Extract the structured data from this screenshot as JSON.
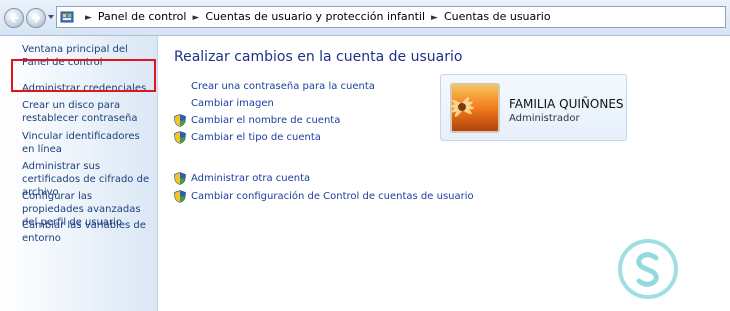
{
  "breadcrumb": [
    "Panel de control",
    "Cuentas de usuario y protección infantil",
    "Cuentas de usuario"
  ],
  "sidebar": {
    "links": [
      "Ventana principal del Panel de control",
      "Administrar credenciales",
      "Crear un disco para restablecer contraseña",
      "Vincular identificadores en línea",
      "Administrar sus certificados de cifrado de archivo",
      "Configurar las propiedades avanzadas del perfil de usuario",
      "Cambiar las variables de entorno"
    ],
    "highlighted_index": 2
  },
  "main": {
    "title": "Realizar cambios en la cuenta de usuario",
    "tasks": [
      {
        "label": "Crear una contraseña para la cuenta",
        "shield": false
      },
      {
        "label": "Cambiar imagen",
        "shield": false
      },
      {
        "label": "Cambiar el nombre de cuenta",
        "shield": true
      },
      {
        "label": "Cambiar el tipo de cuenta",
        "shield": true
      }
    ],
    "other_tasks": [
      {
        "label": "Administrar otra cuenta",
        "shield": true
      },
      {
        "label": "Cambiar configuración de Control de cuentas de usuario",
        "shield": true
      }
    ]
  },
  "account": {
    "name": "FAMILIA QUIÑONES",
    "role": "Administrador"
  },
  "icons": [
    "back-arrow-icon",
    "forward-arrow-icon",
    "control-panel-icon",
    "uac-shield-icon",
    "flower-avatar-icon",
    "watermark-logo-icon"
  ],
  "colors": {
    "link": "#1c3fa0",
    "title": "#1e3287",
    "highlight": "#e3151c",
    "watermark": "#7fd3d8"
  }
}
